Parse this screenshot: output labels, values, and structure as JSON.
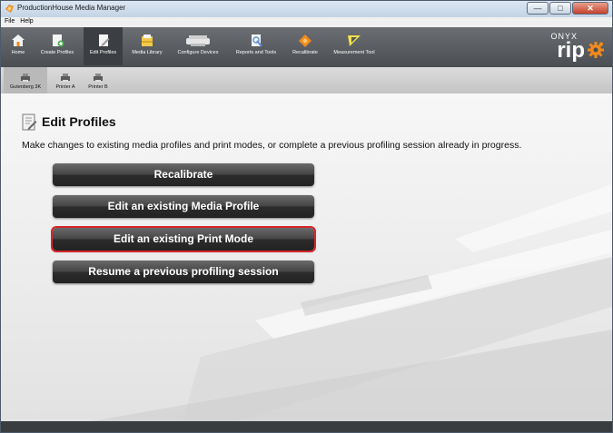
{
  "window": {
    "title": "ProductionHouse Media Manager",
    "controls": {
      "minimize": "—",
      "maximize": "□",
      "close": "✕"
    }
  },
  "menu": [
    "File",
    "Help"
  ],
  "toolbar": {
    "items": [
      {
        "label": "Home",
        "icon": "home-icon"
      },
      {
        "label": "Create Profiles",
        "icon": "create-profiles-icon"
      },
      {
        "label": "Edit Profiles",
        "icon": "edit-profiles-icon",
        "active": true
      },
      {
        "label": "Media Library",
        "icon": "media-library-icon"
      },
      {
        "label": "Configure Devices",
        "icon": "printer-icon"
      },
      {
        "label": "Reports and Tools",
        "icon": "reports-icon"
      },
      {
        "label": "Recalibrate",
        "icon": "recalibrate-icon"
      },
      {
        "label": "Measurement Tool",
        "icon": "measurement-icon"
      }
    ],
    "brand": {
      "top": "ONYX",
      "main": "rip"
    }
  },
  "printers": [
    {
      "label": "Gutenberg 3K",
      "active": true
    },
    {
      "label": "Printer A"
    },
    {
      "label": "Printer B"
    }
  ],
  "page": {
    "title": "Edit Profiles",
    "description": "Make changes to existing media profiles and print modes, or complete a previous profiling session already in progress."
  },
  "actions": [
    {
      "label": "Recalibrate"
    },
    {
      "label": "Edit an existing Media Profile"
    },
    {
      "label": "Edit an existing Print Mode",
      "selected": true
    },
    {
      "label": "Resume a previous profiling session"
    }
  ],
  "colors": {
    "accent": "#d8262a",
    "toolbar": "#55585c",
    "brand_orange": "#f08a1c"
  }
}
